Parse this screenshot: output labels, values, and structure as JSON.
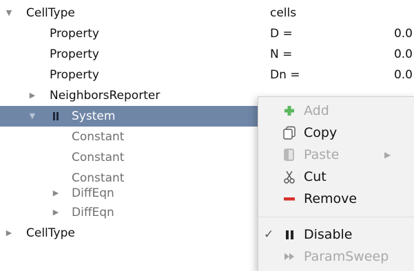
{
  "tree": {
    "rows": [
      {
        "label": "CellType",
        "value": "cells",
        "number": ""
      },
      {
        "label": "Property",
        "value": "D =",
        "number": "0.0"
      },
      {
        "label": "Property",
        "value": "N =",
        "number": "0.0"
      },
      {
        "label": "Property",
        "value": "Dn =",
        "number": "0.0"
      },
      {
        "label": "NeighborsReporter",
        "value": "",
        "number": ""
      },
      {
        "label": "System",
        "value": "",
        "number": ""
      },
      {
        "label": "Constant",
        "value": "",
        "number": ""
      },
      {
        "label": "Constant",
        "value": "",
        "number": ""
      },
      {
        "label": "Constant",
        "value": "",
        "number": ""
      },
      {
        "label": "DiffEqn",
        "value": "",
        "number": ""
      },
      {
        "label": "DiffEqn",
        "value": "",
        "number": ""
      },
      {
        "label": "CellType",
        "value": "",
        "number": ""
      }
    ],
    "selected_row": "System"
  },
  "context_menu": {
    "items": [
      {
        "label": "Add",
        "icon": "plus-icon",
        "enabled": false
      },
      {
        "label": "Copy",
        "icon": "copy-icon",
        "enabled": true
      },
      {
        "label": "Paste",
        "icon": "paste-icon",
        "enabled": false,
        "has_submenu": true
      },
      {
        "label": "Cut",
        "icon": "scissors-icon",
        "enabled": true
      },
      {
        "label": "Remove",
        "icon": "minus-icon",
        "enabled": true
      },
      {
        "label": "Disable",
        "icon": "pause-icon",
        "enabled": true,
        "checked": true
      },
      {
        "label": "ParamSweep",
        "icon": "fast-forward-icon",
        "enabled": false
      }
    ]
  },
  "colors": {
    "selection": "#6f86a7",
    "add_icon": "#5cb85c",
    "remove_icon": "#d9302b",
    "menu_background": "#f2f2f2"
  }
}
